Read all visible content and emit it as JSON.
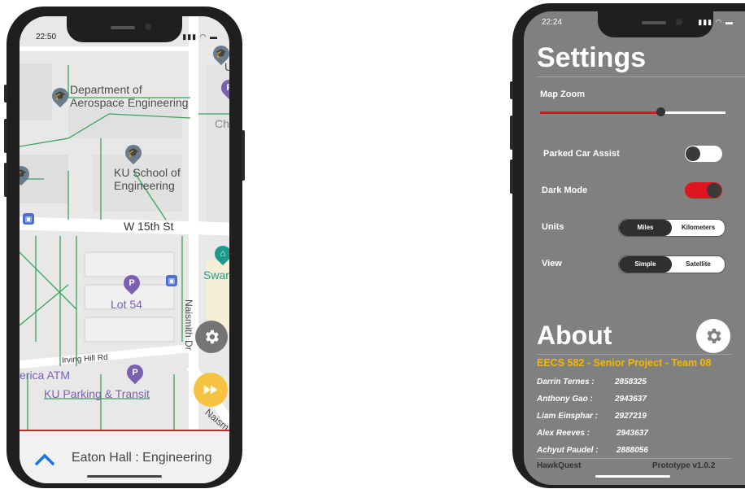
{
  "left_phone": {
    "status": {
      "time": "22:50",
      "icons": "▮▮▮ ◠ ▬"
    },
    "map_labels": {
      "aerospace": "Department of\nAerospace Engineering",
      "ku_school": "KU School of\nEngineering",
      "street_15th": "W 15th St",
      "lot54": "Lot 54",
      "naismith": "Naismith Dr",
      "irving": "Irving Hill Rd",
      "atm": "erica ATM",
      "parking": "KU Parking & Transit",
      "swarth": "Swartl",
      "cha": "Cha",
      "nais2": "Naism",
      "u_partial": "U"
    },
    "bottom_sheet": {
      "title": "Eaton Hall : Engineering"
    },
    "icons": {
      "settings": "gear-icon",
      "fast_forward": "fast-forward-icon",
      "expand": "chevron-up-icon"
    },
    "colors": {
      "route_green": "#3aa35a",
      "accent_red": "#c62828",
      "fab_yellow": "#f5c242",
      "fab_gray": "#757575",
      "chevron_blue": "#1a73e8"
    }
  },
  "right_phone": {
    "status": {
      "time": "22:24",
      "icons": "▮▮▮ ◠ ▬"
    },
    "title": "Settings",
    "map_zoom": {
      "label": "Map Zoom",
      "level": 0.65
    },
    "parked_car_assist": {
      "label": "Parked Car Assist",
      "on": false
    },
    "dark_mode": {
      "label": "Dark Mode",
      "on": true
    },
    "units": {
      "label": "Units",
      "options": [
        "Miles",
        "Kilometers"
      ],
      "selected": "Miles"
    },
    "view": {
      "label": "View",
      "options": [
        "Simple",
        "Satellite"
      ],
      "selected": "Simple"
    },
    "about": {
      "title": "About",
      "subtitle": "EECS 582 - Senior Project - Team 08",
      "members": [
        {
          "name": "Darrin Ternes :",
          "id": "2858325"
        },
        {
          "name": "Anthony Gao :",
          "id": "2943637"
        },
        {
          "name": "Liam Einsphar :",
          "id": "2927219"
        },
        {
          "name": "Alex Reeves :",
          "id": "2943637"
        },
        {
          "name": "Achyut Paudel :",
          "id": "2888056"
        }
      ],
      "app_name": "HawkQuest",
      "version": "Prototype v1.0.2"
    },
    "colors": {
      "background": "#808080",
      "accent_red": "#e0141e",
      "subtitle_yellow": "#f5b800"
    }
  }
}
